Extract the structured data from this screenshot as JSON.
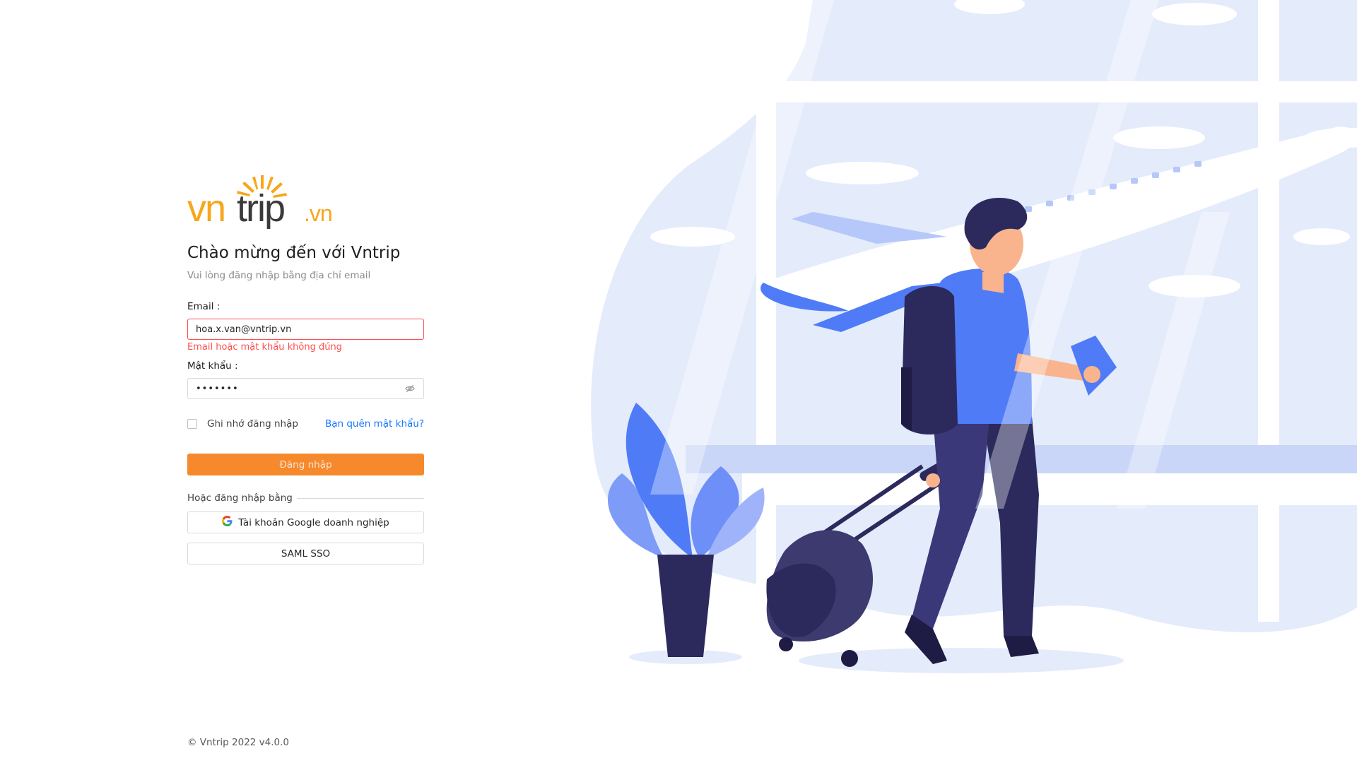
{
  "brand": {
    "logo_text_main": "vntrip",
    "logo_text_suffix": ".vn",
    "colors": {
      "orange": "#f6a71c",
      "dark": "#3a3a3a",
      "accent_button": "#f6892c",
      "link": "#1677ff",
      "error": "#ff4d4f"
    }
  },
  "login": {
    "title": "Chào mừng đến với Vntrip",
    "subtitle": "Vui lòng đăng nhập bằng địa chỉ email",
    "email_label": "Email :",
    "email_value": "hoa.x.van@vntrip.vn",
    "email_error": "Email hoặc mật khẩu không đúng",
    "password_label": "Mật khẩu :",
    "password_value": "•••••••",
    "password_toggle_icon": "eye-invisible-icon",
    "remember_label": "Ghi nhớ đăng nhập",
    "remember_checked": false,
    "forgot_label": "Bạn quên mật khẩu?",
    "submit_label": "Đăng nhập",
    "or_label": "Hoặc đăng nhập bằng",
    "google_label": "Tài khoản Google doanh nghiệp",
    "google_icon": "google-icon",
    "saml_label": "SAML SSO"
  },
  "footer": {
    "text": "© Vntrip 2022 v4.0.0"
  },
  "illustration": {
    "subject": "traveler-with-luggage-and-airplane",
    "colors": {
      "blue": "#4f7cf6",
      "light_blue": "#dfe7fb",
      "navy": "#2c2a5c",
      "skin": "#f9b48e"
    }
  }
}
